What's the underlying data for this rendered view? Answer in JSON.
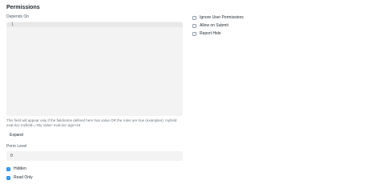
{
  "section": {
    "title": "Permissions"
  },
  "depends_on": {
    "label": "Depends On",
    "line_number": "1",
    "help": "This field will appear only if the fieldname defined here has value OR the rules are true (examples): myfield eval:doc.myfield=='My Value' eval:doc.age>18",
    "expand_label": "Expand"
  },
  "perm_level": {
    "label": "Perm Level",
    "value": "0"
  },
  "left_checks": [
    {
      "label": "Hidden",
      "checked": true
    },
    {
      "label": "Read Only",
      "checked": true
    }
  ],
  "right_checks": [
    {
      "label": "Ignore User Permissions",
      "checked": false
    },
    {
      "label": "Allow on Submit",
      "checked": false
    },
    {
      "label": "Report Hide",
      "checked": false
    }
  ],
  "colors": {
    "accent": "#2490ef",
    "field_bg": "#f3f3f3"
  }
}
